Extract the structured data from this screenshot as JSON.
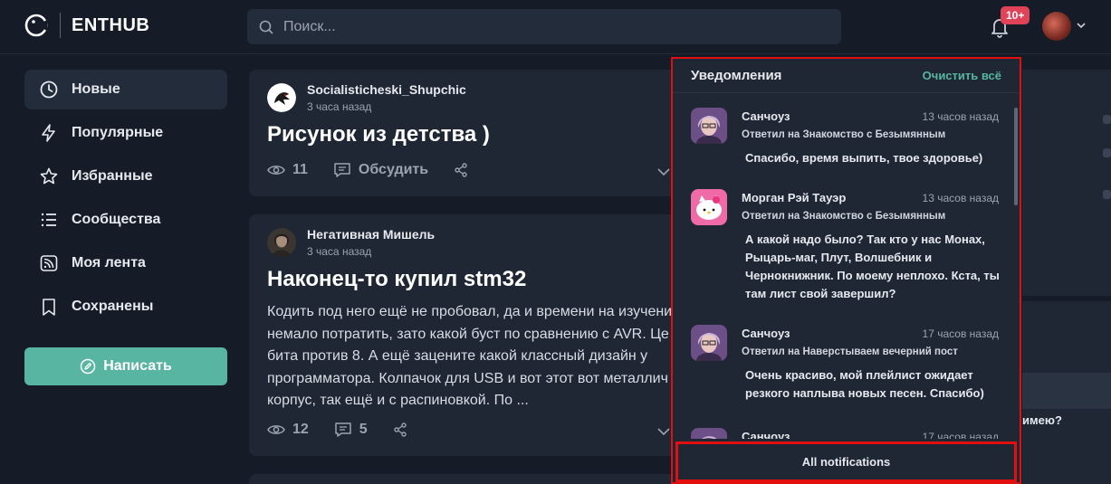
{
  "header": {
    "logo_text": "ENTHUB",
    "search_placeholder": "Поиск...",
    "notif_badge": "10+"
  },
  "sidebar": {
    "items": [
      {
        "label": "Новые",
        "icon": "clock-icon",
        "active": true
      },
      {
        "label": "Популярные",
        "icon": "lightning-icon"
      },
      {
        "label": "Избранные",
        "icon": "star-icon"
      },
      {
        "label": "Сообщества",
        "icon": "list-icon"
      },
      {
        "label": "Моя лента",
        "icon": "rss-icon"
      },
      {
        "label": "Сохранены",
        "icon": "bookmark-icon"
      }
    ],
    "write_label": "Написать"
  },
  "feed": {
    "posts": [
      {
        "author": "Socialisticheski_Shupchic",
        "time": "3 часа назад",
        "title": "Рисунок из детства )",
        "views": "11",
        "discuss": "Обсудить"
      },
      {
        "author": "Негативная Мишель",
        "time": "3 часа назад",
        "title": "Наконец-то купил stm32",
        "body": "Кодить под него ещё не пробовал, да и времени на изучени\nнемало потратить, зато какой буст по сравнению с AVR.  Це\nбита против 8. А ещё зацените какой классный дизайн у\nпрограмматора. Колпачок для USB и вот этот вот металлич\nкорпус, так ещё и с распиновкой. По ...",
        "views": "12",
        "comments": "5"
      }
    ]
  },
  "right_panel": {
    "partial_text": "имею?"
  },
  "notifications": {
    "title": "Уведомления",
    "clear_label": "Очистить всё",
    "items": [
      {
        "name": "Санчоуз",
        "time": "13 часов назад",
        "sub": "Ответил на Знакомство с Безымянным",
        "text": "Спасибо, время выпить, твое здоровье)"
      },
      {
        "name": "Морган Рэй Тауэр",
        "time": "13 часов назад",
        "sub": "Ответил на Знакомство с Безымянным",
        "text": "А какой надо было? Так кто у нас Монах, Рыцарь-маг, Плут, Волшебник и Чернокнижник. По моему неплохо. Кста, ты там лист свой завершил?"
      },
      {
        "name": "Санчоуз",
        "time": "17 часов назад",
        "sub": "Ответил на Наверстываем вечерний пост",
        "text": "Очень красиво, мой плейлист ожидает резкого наплыва новых песен. Спасибо)"
      },
      {
        "name": "Санчоуз",
        "time": "17 часов назад",
        "sub": "",
        "text": ""
      }
    ],
    "footer_label": "All notifications"
  },
  "colors": {
    "background": "#151c27",
    "card": "#1f2734",
    "accent": "#57b5a2",
    "badge": "#e04358",
    "highlight_border": "#e01010"
  }
}
